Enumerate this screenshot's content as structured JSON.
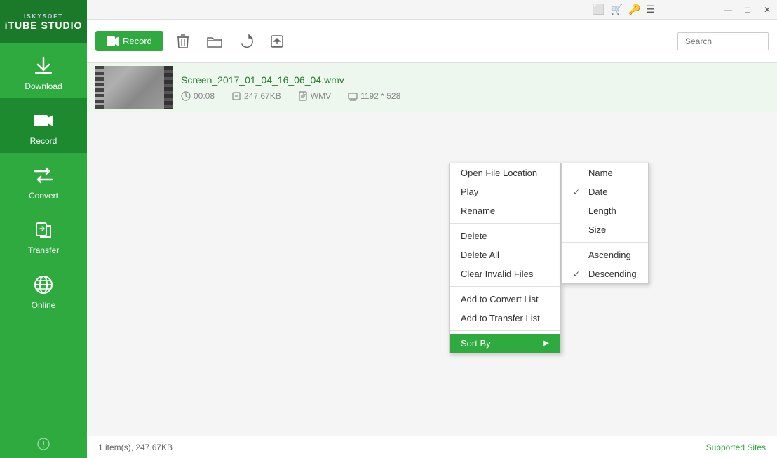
{
  "app": {
    "logo_top": "ISKYSOFT",
    "logo_bottom": "iTUBE STUDIO"
  },
  "sidebar": {
    "items": [
      {
        "id": "download",
        "label": "Download",
        "active": false
      },
      {
        "id": "record",
        "label": "Record",
        "active": true
      },
      {
        "id": "convert",
        "label": "Convert",
        "active": false
      },
      {
        "id": "transfer",
        "label": "Transfer",
        "active": false
      },
      {
        "id": "online",
        "label": "Online",
        "active": false
      }
    ]
  },
  "toolbar": {
    "record_label": "Record",
    "search_placeholder": "Search"
  },
  "file": {
    "name": "Screen_2017_01_04_16_06_04.wmv",
    "duration": "00:08",
    "size": "247.67KB",
    "format": "WMV",
    "resolution": "1192 * 528"
  },
  "context_menu": {
    "items": [
      {
        "id": "open-file-location",
        "label": "Open File Location",
        "separator_after": false
      },
      {
        "id": "play",
        "label": "Play",
        "separator_after": false
      },
      {
        "id": "rename",
        "label": "Rename",
        "separator_after": true
      },
      {
        "id": "delete",
        "label": "Delete",
        "separator_after": false
      },
      {
        "id": "delete-all",
        "label": "Delete All",
        "separator_after": false
      },
      {
        "id": "clear-invalid",
        "label": "Clear Invalid Files",
        "separator_after": true
      },
      {
        "id": "add-convert",
        "label": "Add to Convert List",
        "separator_after": false
      },
      {
        "id": "add-transfer",
        "label": "Add to Transfer List",
        "separator_after": true
      },
      {
        "id": "sort-by",
        "label": "Sort By",
        "highlighted": true,
        "has_submenu": true
      }
    ]
  },
  "submenu": {
    "sort_options": [
      {
        "id": "name",
        "label": "Name",
        "checked": false
      },
      {
        "id": "date",
        "label": "Date",
        "checked": true
      },
      {
        "id": "length",
        "label": "Length",
        "checked": false
      },
      {
        "id": "size",
        "label": "Size",
        "checked": false
      }
    ],
    "order_options": [
      {
        "id": "ascending",
        "label": "Ascending",
        "checked": false
      },
      {
        "id": "descending",
        "label": "Descending",
        "checked": true
      }
    ]
  },
  "status_bar": {
    "text": "1 item(s), 247.67KB",
    "supported_sites": "Supported Sites"
  },
  "window_controls": {
    "minimize": "—",
    "maximize": "□",
    "close": "✕"
  }
}
